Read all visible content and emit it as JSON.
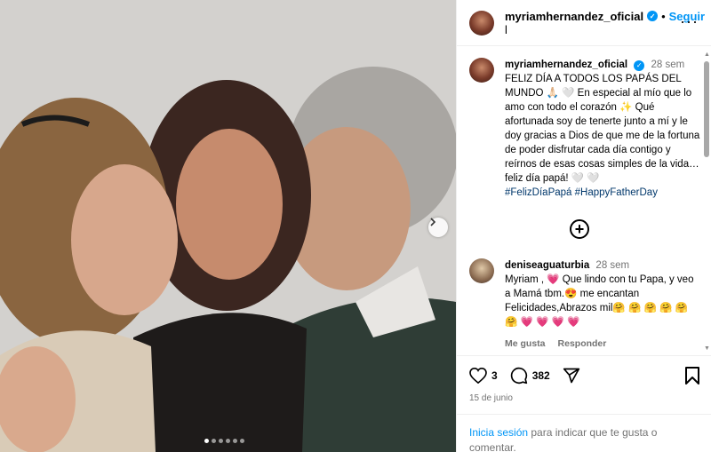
{
  "post": {
    "author": "myriamhernandez_oficial",
    "follow_label": "Seguir",
    "header_more": "···",
    "header_extra": "l",
    "carousel": {
      "slide_count": 6,
      "active_index": 0
    }
  },
  "caption": {
    "username": "myriamhernandez_oficial",
    "time": "28 sem",
    "text": "FELIZ DÍA A TODOS LOS PAPÁS DEL MUNDO 🙏🏻 🤍  En especial al mío que lo amo con todo el corazón ✨ Qué afortunada soy de tenerte junto a mí y le doy gracias a Dios de que me de la fortuna de poder disfrutar cada día contigo y reírnos de esas cosas simples de la vida… feliz día papá! 🤍 🤍",
    "hashtags": "#FelizDíaPapá #HappyFatherDay"
  },
  "comment": {
    "username": "deniseaguaturbia",
    "time": "28 sem",
    "text": "Myriam , 💗 Que lindo con tu Papa, y veo a Mamá tbm.😍  me encantan Felicidades,Abrazos mil🤗 🤗 🤗 🤗 🤗 🤗 💗 💗 💗 💗",
    "like_label": "Me gusta",
    "reply_label": "Responder"
  },
  "stats": {
    "likes": "3",
    "comments": "382",
    "date": "15 de junio"
  },
  "login": {
    "link": "Inicia sesión",
    "rest": " para indicar que te gusta o comentar."
  },
  "colors": {
    "accent": "#0095f6",
    "muted": "#737373",
    "hashtag": "#00376b"
  }
}
